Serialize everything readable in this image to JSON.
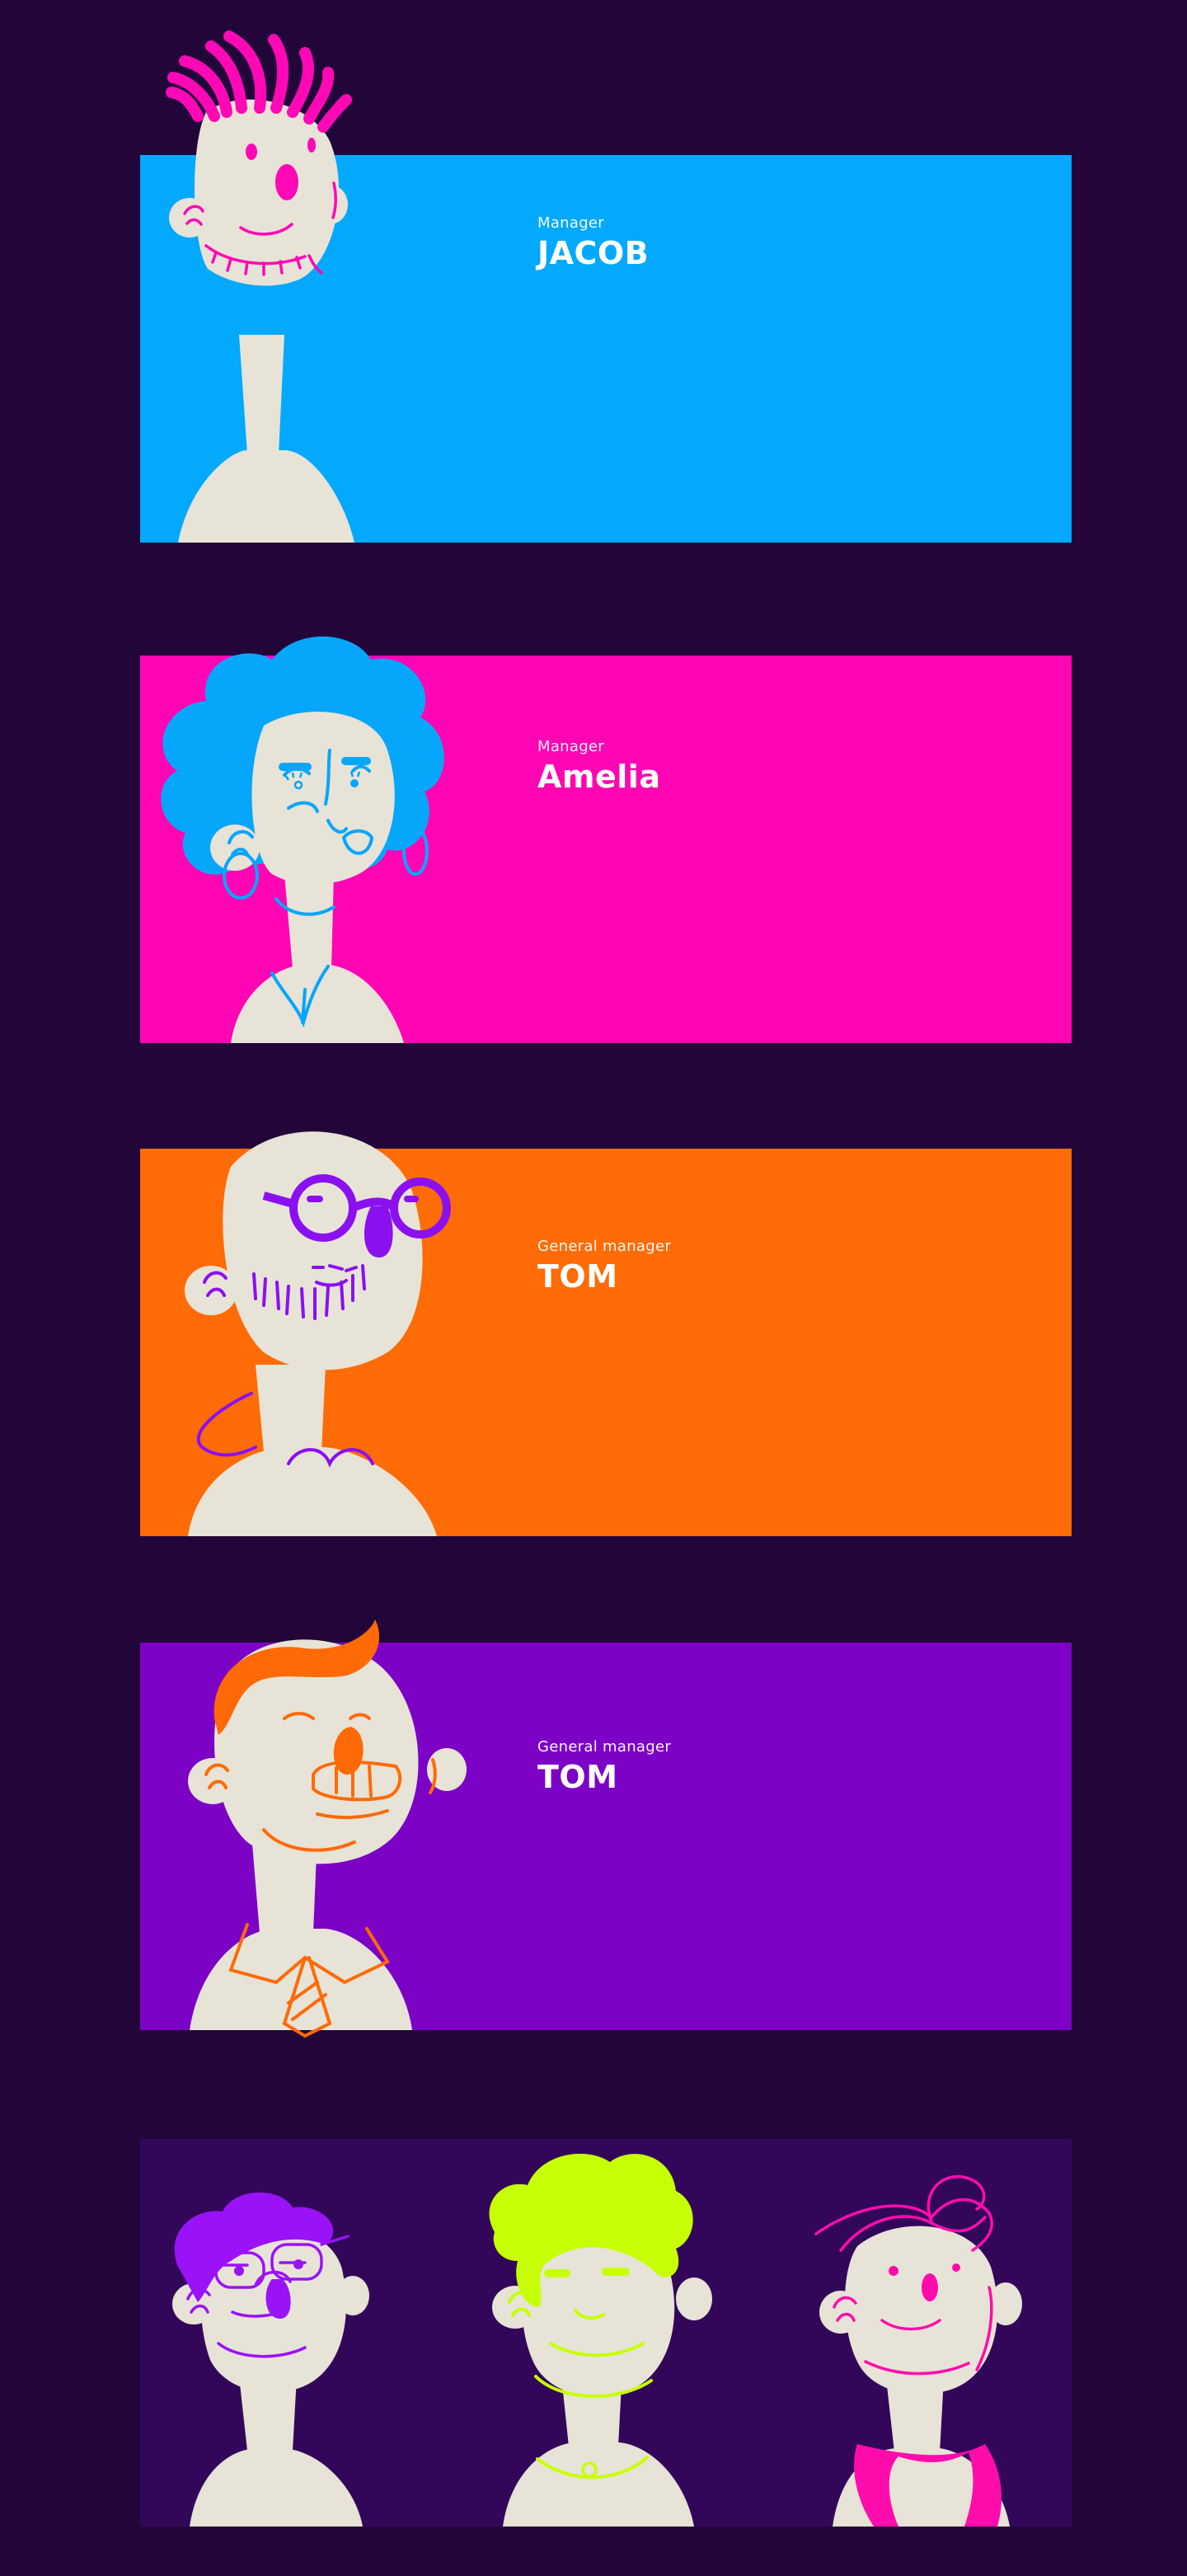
{
  "colors": {
    "page_background": "#22063a",
    "skin": "#e7e3d6",
    "card_blue": "#02a9fd",
    "card_pink": "#ff05b3",
    "card_orange": "#ff6b06",
    "card_purple": "#7c03c5",
    "card_dark": "#32075a"
  },
  "cards": [
    {
      "role": "Manager",
      "name": "JACOB",
      "background": "#02a9fd",
      "accent": "#ff08b5",
      "avatar": "spiky-hair-avatar"
    },
    {
      "role": "Manager",
      "name": "Amelia",
      "background": "#ff05b3",
      "accent": "#06a6fb",
      "avatar": "curly-hair-woman-avatar"
    },
    {
      "role": "General manager",
      "name": "TOM",
      "background": "#ff6b06",
      "accent": "#8a10f0",
      "avatar": "bald-glasses-beard-avatar"
    },
    {
      "role": "General manager",
      "name": "TOM",
      "background": "#7c03c5",
      "accent": "#ff6a07",
      "avatar": "redhead-tie-avatar"
    }
  ],
  "group_card": {
    "background": "#32075a",
    "avatars": [
      {
        "avatar": "glasses-purple-hair-avatar",
        "accent": "#9a12f7"
      },
      {
        "avatar": "lime-hair-avatar",
        "accent": "#c7ff06"
      },
      {
        "avatar": "pink-swoosh-hair-avatar",
        "accent": "#ff0cad"
      }
    ]
  }
}
